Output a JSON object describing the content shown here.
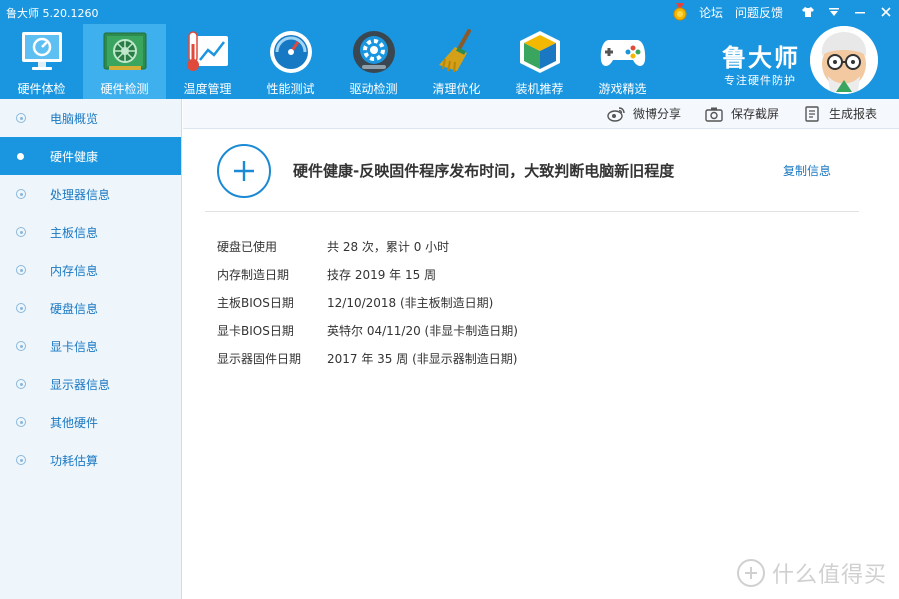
{
  "app": {
    "title": "鲁大师 5.20.1260",
    "links": {
      "forum": "论坛",
      "feedback": "问题反馈"
    }
  },
  "nav": {
    "items": [
      {
        "label": "硬件体检",
        "icon": "monitor-check-icon"
      },
      {
        "label": "硬件检测",
        "icon": "hardware-board-icon"
      },
      {
        "label": "温度管理",
        "icon": "thermometer-chart-icon"
      },
      {
        "label": "性能测试",
        "icon": "speedometer-icon"
      },
      {
        "label": "驱动检测",
        "icon": "gear-driver-icon"
      },
      {
        "label": "清理优化",
        "icon": "broom-icon"
      },
      {
        "label": "装机推荐",
        "icon": "cube-icon"
      },
      {
        "label": "游戏精选",
        "icon": "gamepad-icon"
      }
    ],
    "active_index": 1
  },
  "brand": {
    "name": "鲁大师",
    "slogan": "专注硬件防护"
  },
  "sidebar": {
    "items": [
      {
        "label": "电脑概览"
      },
      {
        "label": "硬件健康"
      },
      {
        "label": "处理器信息"
      },
      {
        "label": "主板信息"
      },
      {
        "label": "内存信息"
      },
      {
        "label": "硬盘信息"
      },
      {
        "label": "显卡信息"
      },
      {
        "label": "显示器信息"
      },
      {
        "label": "其他硬件"
      },
      {
        "label": "功耗估算"
      }
    ],
    "active_index": 1
  },
  "toolbar": {
    "weibo_share": "微博分享",
    "save_screenshot": "保存截屏",
    "generate_report": "生成报表"
  },
  "main": {
    "title": "硬件健康-反映固件程序发布时间，大致判断电脑新旧程度",
    "copy_info": "复制信息",
    "rows": [
      {
        "key": "硬盘已使用",
        "value": "共 28 次，累计 0 小时"
      },
      {
        "key": "内存制造日期",
        "value": "技存 2019 年 15 周"
      },
      {
        "key": "主板BIOS日期",
        "value": "12/10/2018 (非主板制造日期)"
      },
      {
        "key": "显卡BIOS日期",
        "value": "英特尔 04/11/20 (非显卡制造日期)"
      },
      {
        "key": "显示器固件日期",
        "value": "2017 年 35 周 (非显示器制造日期)"
      }
    ]
  },
  "watermark": {
    "text": "什么值得买"
  },
  "colors": {
    "brand_blue": "#1a96e0",
    "active_tab": "#3fb0ee",
    "link_blue": "#1a78c2"
  }
}
